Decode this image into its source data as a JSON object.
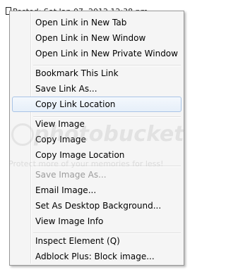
{
  "page": {
    "posted_line": "Posted: Sat Jan 07, 2012 12:38 pm"
  },
  "menu": {
    "items": [
      {
        "label": "Open Link in New Tab"
      },
      {
        "label": "Open Link in New Window"
      },
      {
        "label": "Open Link in New Private Window"
      },
      {
        "label": "Bookmark This Link"
      },
      {
        "label": "Save Link As..."
      },
      {
        "label": "Copy Link Location",
        "state": "highlighted"
      },
      {
        "label": "View Image"
      },
      {
        "label": "Copy Image"
      },
      {
        "label": "Copy Image Location"
      },
      {
        "label": "Save Image As...",
        "state": "disabled"
      },
      {
        "label": "Email Image..."
      },
      {
        "label": "Set As Desktop Background..."
      },
      {
        "label": "View Image Info"
      },
      {
        "label": "Inspect Element (Q)"
      },
      {
        "label": "Adblock Plus: Block image..."
      }
    ]
  },
  "watermark": {
    "brand": "photobucket",
    "tagline": "Protect more of your memories for less!"
  },
  "colors": {
    "menu_background": "#f5f5f5",
    "highlight_border": "#a9c4e6",
    "disabled_text": "#9b9b9b"
  }
}
